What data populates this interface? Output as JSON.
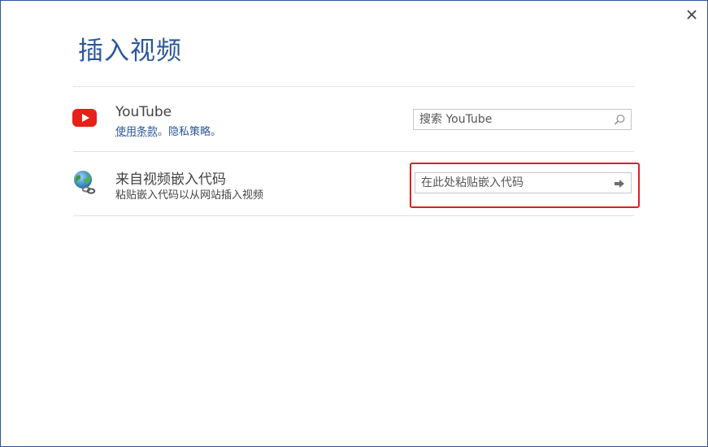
{
  "dialog": {
    "title": "插入视频",
    "close_icon": "close-icon"
  },
  "youtube": {
    "icon": "youtube-icon",
    "icon_color": "#e62117",
    "title": "YouTube",
    "terms_link": "使用条款",
    "separator": "。",
    "privacy_link": "隐私策略",
    "end": "。",
    "search_placeholder": "搜索 YouTube",
    "search_icon": "search-icon"
  },
  "embed": {
    "icon": "globe-link-icon",
    "title": "来自视频嵌入代码",
    "subtitle": "粘贴嵌入代码以从网站插入视频",
    "input_placeholder": "在此处粘贴嵌入代码",
    "insert_icon": "arrow-right-icon"
  },
  "accent_color": "#2b579a",
  "highlight_color": "#e21d1d"
}
